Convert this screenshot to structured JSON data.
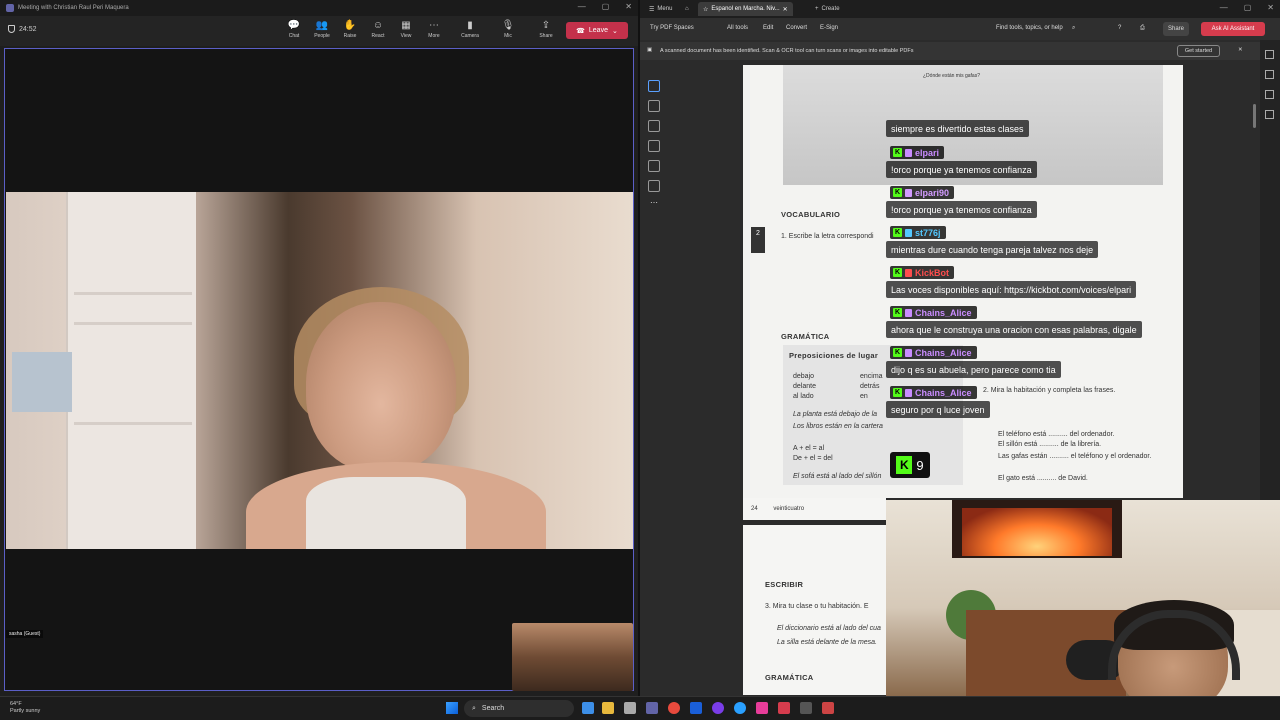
{
  "teams": {
    "window_title": "Meeting with Christian Raul Peri Maquera",
    "timer": "24:52",
    "toolbar": [
      {
        "icon": "chat-icon",
        "glyph": "💬",
        "label": "Chat"
      },
      {
        "icon": "people-icon",
        "glyph": "👥",
        "label": "People"
      },
      {
        "icon": "raise-hand-icon",
        "glyph": "✋",
        "label": "Raise"
      },
      {
        "icon": "react-icon",
        "glyph": "☺",
        "label": "React"
      },
      {
        "icon": "view-icon",
        "glyph": "▦",
        "label": "View"
      },
      {
        "icon": "more-icon",
        "glyph": "⋯",
        "label": "More"
      },
      {
        "icon": "camera-icon",
        "glyph": "▮",
        "label": "Camera"
      },
      {
        "icon": "mic-icon",
        "glyph": "🎙",
        "label": "Mic"
      },
      {
        "icon": "share-icon",
        "glyph": "⇪",
        "label": "Share"
      }
    ],
    "leave_label": "Leave",
    "participant_name": "sasha (Guest)"
  },
  "browser": {
    "tabs": [
      {
        "label": "Menu"
      },
      {
        "label": "Espanol en Marcha. Niv..."
      },
      {
        "label": "Create"
      }
    ],
    "toolbar": {
      "try_spaces": "Try PDF Spaces",
      "all_tools": "All tools",
      "edit": "Edit",
      "convert": "Convert",
      "esign": "E-Sign",
      "find": "Find tools, topics, or help",
      "share": "Share",
      "ai_assistant": "Ask AI Assistant"
    },
    "banner": {
      "text": "A scanned document has been identified. Scan & OCR tool can turn scans or images into editable PDFs",
      "button": "Get started"
    }
  },
  "pdf": {
    "bubble": "¿Dónde están mis gafas?",
    "vocabulario": "VOCABULARIO",
    "exercise1": "1. Escribe la letra correspondi",
    "gramatica": "GRAMÁTICA",
    "prepositions_title": "Preposiciones de lugar",
    "prep_col1": [
      "debajo",
      "delante",
      "al lado"
    ],
    "prep_col2": [
      "encima",
      "detrás",
      "en"
    ],
    "prep_example1": "La planta está debajo de la",
    "prep_example2": "Los libros están en la cartera",
    "contraction1": "A + el = al",
    "contraction2": "De + el = del",
    "prep_example3": "El sofá está al lado del sillón",
    "exercise2": "2. Mira la habitación y completa las frases.",
    "sentences": [
      "El teléfono está .......... del ordenador.",
      "El sillón está .......... de la librería.",
      "Las gafas están .......... el teléfono y el ordenador.",
      "El gato está .......... de David."
    ],
    "chapter": "2",
    "page_number": "24",
    "page_word": "veinticuatro",
    "escribir": "ESCRIBIR",
    "exercise3": "3. Mira tu clase o tu habitación. E",
    "p2_line1": "El diccionario está al lado del cua",
    "p2_line2": "La silla está delante de la mesa.",
    "p2_gramatica": "GRAMÁTICA"
  },
  "chat": {
    "top_text": "siempre es divertido estas clases",
    "messages": [
      {
        "user": "elpari",
        "color": "#c98cff",
        "text": "!orco porque ya tenemos confianza"
      },
      {
        "user": "elpari90",
        "color": "#d29bff",
        "text": "!orco porque ya tenemos confianza"
      },
      {
        "user": "st776j",
        "color": "#53c8ff",
        "text": "mientras dure cuando tenga pareja talvez nos deje"
      },
      {
        "user": "KickBot",
        "color": "#ff4d4d",
        "text": "Las voces disponibles aquí: https://kickbot.com/voices/elpari"
      },
      {
        "user": "Chains_Alice",
        "color": "#c98cff",
        "text": "ahora que le construya una oracion con esas palabras, digale"
      },
      {
        "user": "Chains_Alice",
        "color": "#c98cff",
        "text": "dijo q es su abuela, pero parece como tia"
      },
      {
        "user": "Chains_Alice",
        "color": "#c98cff",
        "text": "seguro por q luce joven"
      }
    ],
    "viewer_count": "9"
  },
  "taskbar": {
    "temp": "64°F",
    "weather": "Partly sunny",
    "search": "Search"
  }
}
